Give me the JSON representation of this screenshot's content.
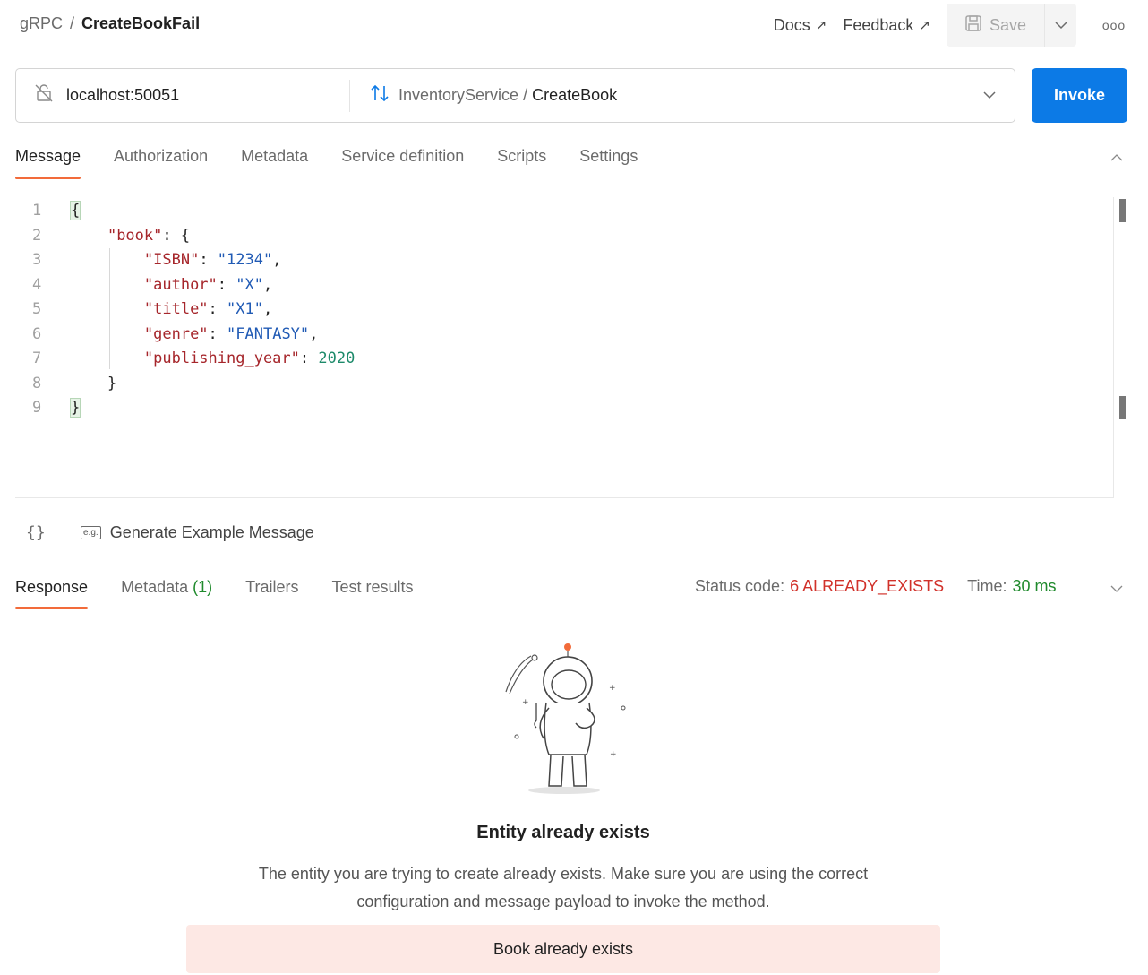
{
  "header": {
    "breadcrumb_root": "gRPC",
    "breadcrumb_sep": "/",
    "breadcrumb_current": "CreateBookFail",
    "docs_label": "Docs",
    "feedback_label": "Feedback",
    "save_label": "Save",
    "more_label": "ooo"
  },
  "request": {
    "host": "localhost:50051",
    "service": "InventoryService",
    "method_sep": " / ",
    "method": "CreateBook",
    "invoke_label": "Invoke"
  },
  "tabs": [
    "Message",
    "Authorization",
    "Metadata",
    "Service definition",
    "Scripts",
    "Settings"
  ],
  "editor": {
    "line_numbers": [
      "1",
      "2",
      "3",
      "4",
      "5",
      "6",
      "7",
      "8",
      "9"
    ],
    "lines": [
      {
        "indent": "",
        "parts": [
          {
            "t": "p",
            "v": "{"
          }
        ]
      },
      {
        "indent": "    ",
        "parts": [
          {
            "t": "k",
            "v": "\"book\""
          },
          {
            "t": "p",
            "v": ": {"
          }
        ]
      },
      {
        "indent": "        ",
        "parts": [
          {
            "t": "k",
            "v": "\"ISBN\""
          },
          {
            "t": "p",
            "v": ": "
          },
          {
            "t": "s",
            "v": "\"1234\""
          },
          {
            "t": "p",
            "v": ","
          }
        ]
      },
      {
        "indent": "        ",
        "parts": [
          {
            "t": "k",
            "v": "\"author\""
          },
          {
            "t": "p",
            "v": ": "
          },
          {
            "t": "s",
            "v": "\"X\""
          },
          {
            "t": "p",
            "v": ","
          }
        ]
      },
      {
        "indent": "        ",
        "parts": [
          {
            "t": "k",
            "v": "\"title\""
          },
          {
            "t": "p",
            "v": ": "
          },
          {
            "t": "s",
            "v": "\"X1\""
          },
          {
            "t": "p",
            "v": ","
          }
        ]
      },
      {
        "indent": "        ",
        "parts": [
          {
            "t": "k",
            "v": "\"genre\""
          },
          {
            "t": "p",
            "v": ": "
          },
          {
            "t": "s",
            "v": "\"FANTASY\""
          },
          {
            "t": "p",
            "v": ","
          }
        ]
      },
      {
        "indent": "        ",
        "parts": [
          {
            "t": "k",
            "v": "\"publishing_year\""
          },
          {
            "t": "p",
            "v": ": "
          },
          {
            "t": "n",
            "v": "2020"
          }
        ]
      },
      {
        "indent": "    ",
        "parts": [
          {
            "t": "p",
            "v": "}"
          }
        ]
      },
      {
        "indent": "",
        "parts": [
          {
            "t": "p",
            "v": "}"
          }
        ]
      }
    ]
  },
  "editor_footer": {
    "braces_icon": "{}",
    "eg_icon": "e.g.",
    "generate_label": "Generate Example Message"
  },
  "response": {
    "tabs": {
      "response": "Response",
      "metadata": "Metadata",
      "metadata_count": "(1)",
      "trailers": "Trailers",
      "test_results": "Test results"
    },
    "status_label": "Status code:",
    "status_value": "6 ALREADY_EXISTS",
    "time_label": "Time:",
    "time_value": "30 ms",
    "empty_title": "Entity already exists",
    "empty_desc": "The entity you are trying to create already exists. Make sure you are using the correct configuration and message payload to invoke the method.",
    "error_message": "Book already exists"
  },
  "colors": {
    "accent_tab": "#f26b3a",
    "invoke": "#0c7ae6",
    "error": "#d1312a",
    "success": "#1f8a2c",
    "error_bg": "#fde8e4"
  }
}
